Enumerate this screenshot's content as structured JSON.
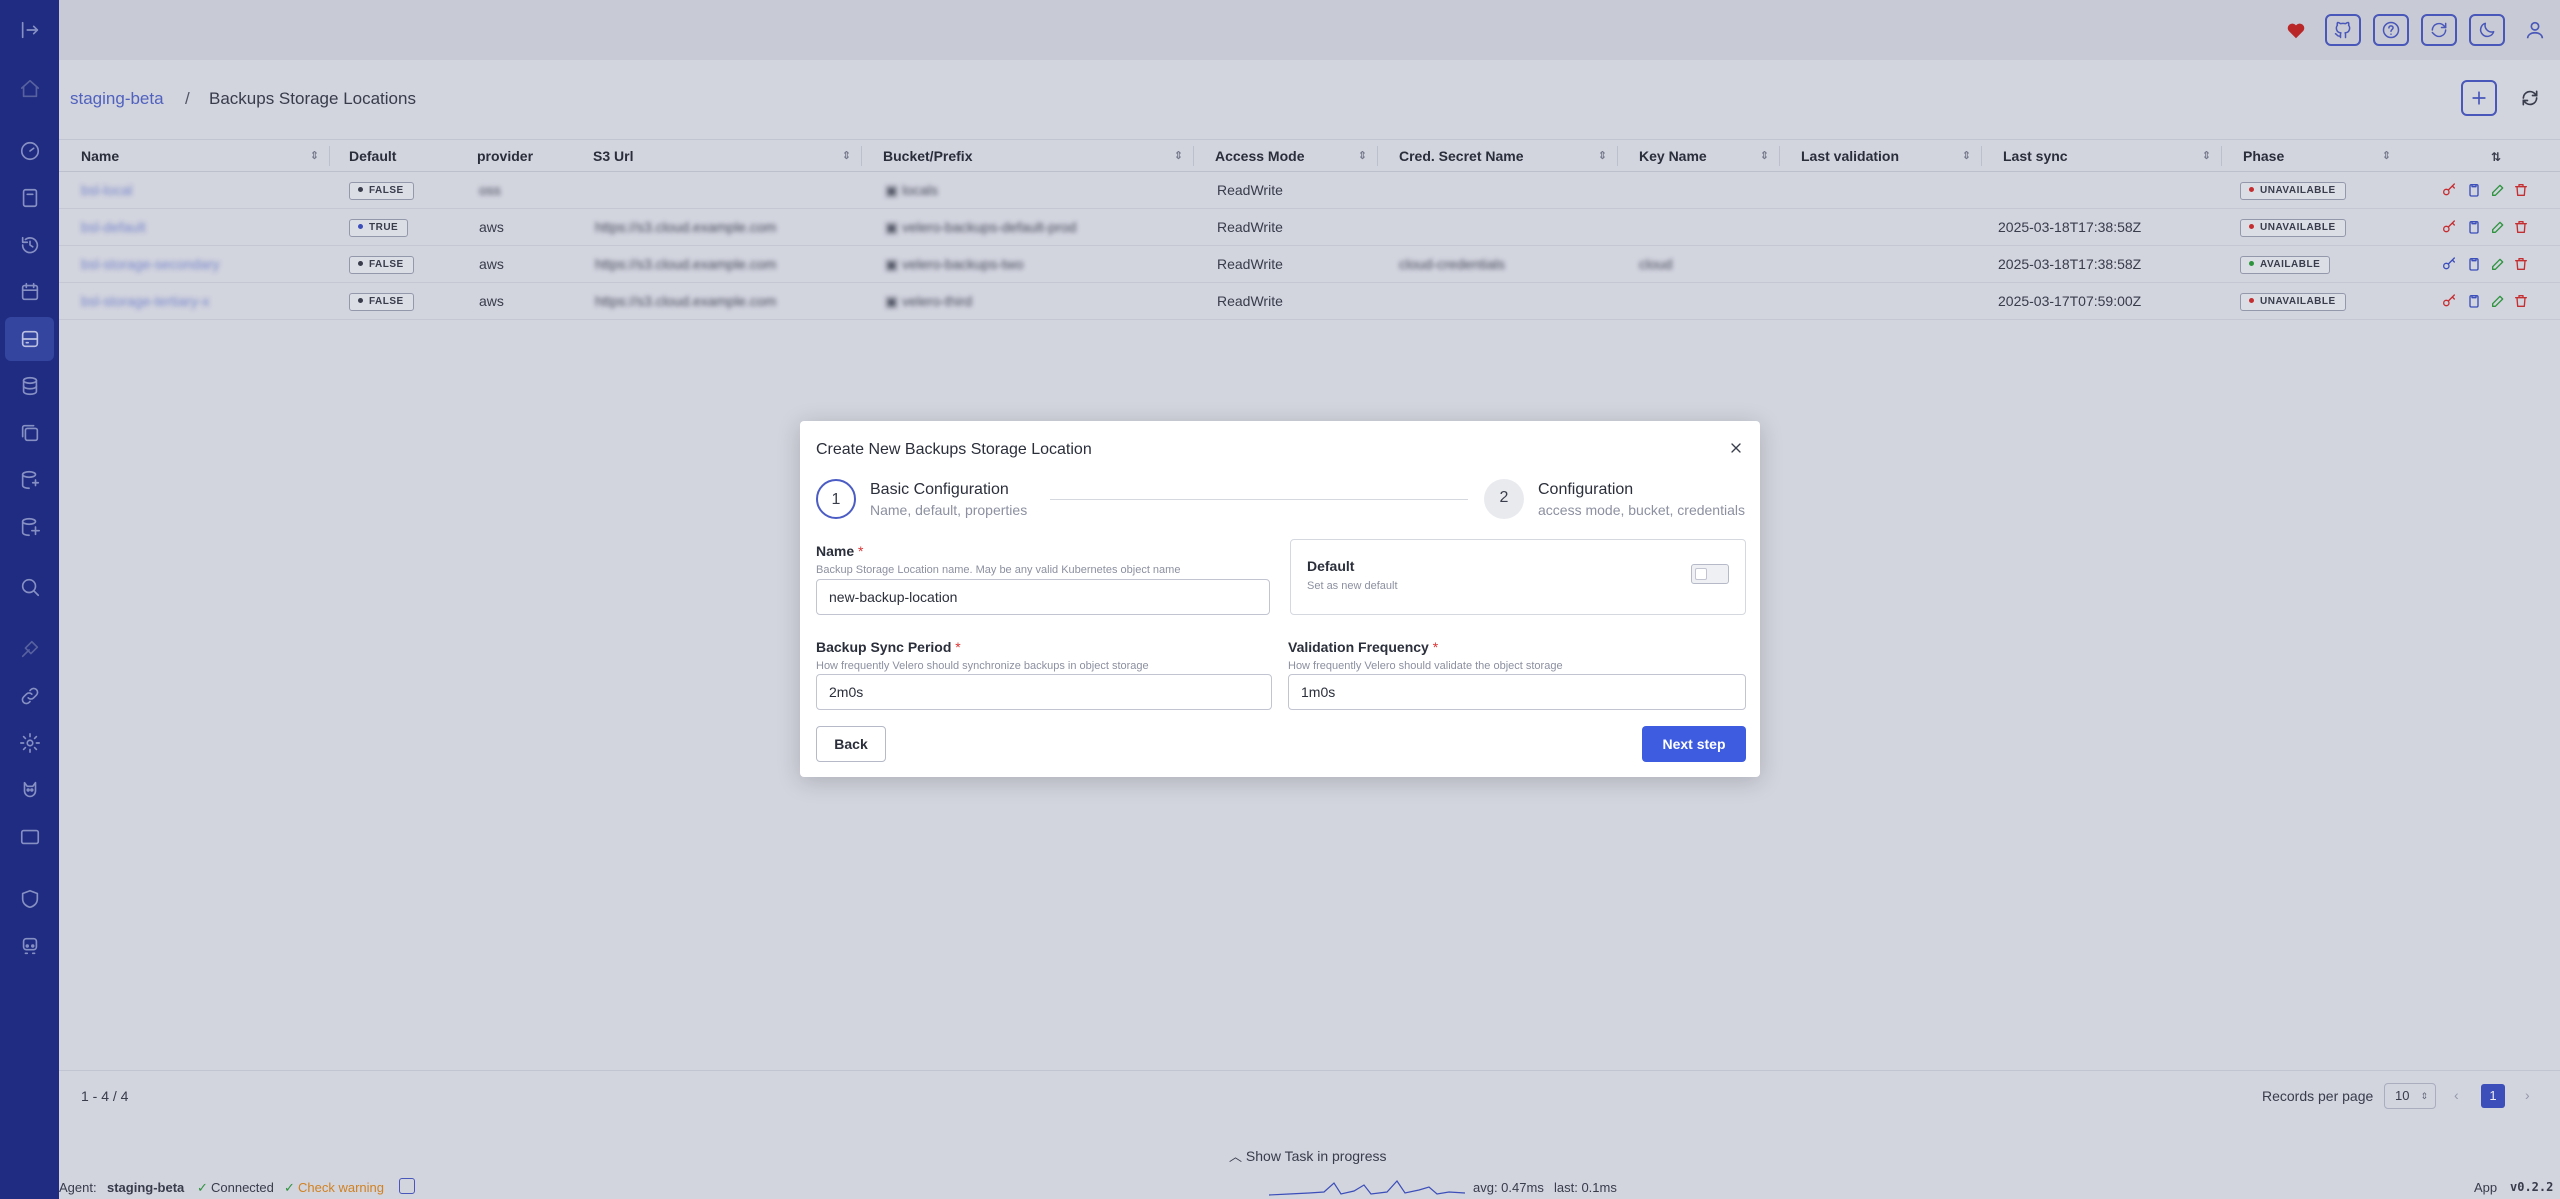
{
  "sidebar": {
    "items": [
      "logout-icon",
      "home-icon",
      "dashboard-icon",
      "backups-icon",
      "restores-icon",
      "schedules-icon",
      "storage-locations-icon",
      "database-icon",
      "snapshots-icon",
      "repositories-icon",
      "repository-locations-icon",
      "inspect-icon",
      "ui-tool-icon",
      "links-icon",
      "settings-icon",
      "watchdog-icon",
      "terminal-icon",
      "security-icon",
      "agents-icon"
    ]
  },
  "breadcrumb": {
    "root": "staging-beta",
    "separator": "/",
    "current": "Backups Storage Locations"
  },
  "table": {
    "columns": [
      "Name",
      "Default",
      "provider",
      "S3 Url",
      "Bucket/Prefix",
      "Access Mode",
      "Cred. Secret Name",
      "Key Name",
      "Last validation",
      "Last sync",
      "Phase"
    ],
    "rows": [
      {
        "name": "bsl-local",
        "default": "FALSE",
        "provider": "oss",
        "s3url": "",
        "bucket": "locals",
        "access": "ReadWrite",
        "cred": "",
        "key": "",
        "lastval": "",
        "lastsync": "",
        "phase": "UNAVAILABLE"
      },
      {
        "name": "bsl-default",
        "default": "TRUE",
        "provider": "aws",
        "s3url": "https://s3.cloud.example.com",
        "bucket": "velero-backups-default-prod",
        "access": "ReadWrite",
        "cred": "",
        "key": "",
        "lastval": "",
        "lastsync": "2025-03-18T17:38:58Z",
        "phase": "UNAVAILABLE"
      },
      {
        "name": "bsl-storage-secondary",
        "default": "FALSE",
        "provider": "aws",
        "s3url": "https://s3.cloud.example.com",
        "bucket": "velero-backups-two",
        "access": "ReadWrite",
        "cred": "cloud-credentials",
        "key": "cloud",
        "lastval": "",
        "lastsync": "2025-03-18T17:38:58Z",
        "phase": "AVAILABLE"
      },
      {
        "name": "bsl-storage-tertiary-x",
        "default": "FALSE",
        "provider": "aws",
        "s3url": "https://s3.cloud.example.com",
        "bucket": "velero-third",
        "access": "ReadWrite",
        "cred": "",
        "key": "",
        "lastval": "",
        "lastsync": "2025-03-17T07:59:00Z",
        "phase": "UNAVAILABLE"
      }
    ]
  },
  "footer": {
    "range": "1 - 4 / 4",
    "records_label": "Records per page",
    "records_value": "10",
    "current_page": "1",
    "prev": "‹",
    "next": "›"
  },
  "task": {
    "toggle_label": "Show Task in progress"
  },
  "status": {
    "agent_label": "Agent:",
    "agent_name": "staging-beta",
    "connected": "Connected",
    "check": "Check warning",
    "avg": "avg: 0.47ms",
    "last": "last: 0.1ms",
    "app_label": "App",
    "version": "v0.2.2"
  },
  "modal": {
    "title": "Create New Backups Storage Location",
    "step1": {
      "num": "1",
      "title": "Basic Configuration",
      "sub": "Name, default, properties"
    },
    "step2": {
      "num": "2",
      "title": "Configuration",
      "sub": "access mode, bucket, credentials"
    },
    "name": {
      "label": "Name",
      "desc": "Backup Storage Location name. May be any valid Kubernetes object name",
      "value": "new-backup-location"
    },
    "default": {
      "title": "Default",
      "sub": "Set as new default"
    },
    "sync": {
      "label": "Backup Sync Period",
      "desc": "How frequently Velero should synchronize backups in object storage",
      "value": "2m0s"
    },
    "validation": {
      "label": "Validation Frequency",
      "desc": "How frequently Velero should validate the object storage",
      "value": "1m0s"
    },
    "back_label": "Back",
    "next_label": "Next step",
    "required_mark": "*"
  },
  "colors": {
    "accent": "#3d5ce0",
    "sidebar": "#1f2d87",
    "available": "#2e9e3e",
    "unavailable": "#d32f2f",
    "true_dot": "#3d52c4"
  }
}
